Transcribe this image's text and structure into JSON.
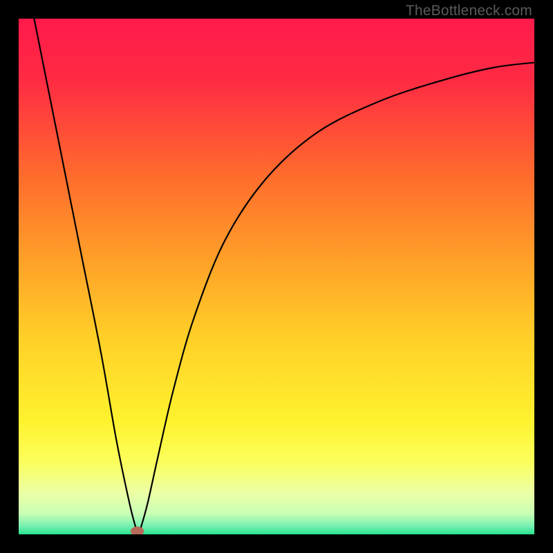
{
  "watermark": "TheBottleneck.com",
  "chart_data": {
    "type": "line",
    "title": "",
    "xlabel": "",
    "ylabel": "",
    "xlim": [
      0,
      100
    ],
    "ylim": [
      0,
      100
    ],
    "background": {
      "type": "vertical-gradient",
      "stops": [
        {
          "offset": 0.0,
          "color": "#ff1a4b"
        },
        {
          "offset": 0.12,
          "color": "#ff2b43"
        },
        {
          "offset": 0.3,
          "color": "#ff6a2d"
        },
        {
          "offset": 0.48,
          "color": "#ffa428"
        },
        {
          "offset": 0.62,
          "color": "#ffd028"
        },
        {
          "offset": 0.78,
          "color": "#fff22e"
        },
        {
          "offset": 0.86,
          "color": "#fbff5c"
        },
        {
          "offset": 0.92,
          "color": "#ecffa6"
        },
        {
          "offset": 0.96,
          "color": "#c8ffb4"
        },
        {
          "offset": 0.985,
          "color": "#72efb0"
        },
        {
          "offset": 1.0,
          "color": "#26e38f"
        }
      ]
    },
    "series": [
      {
        "name": "bottleneck-curve",
        "color": "#000000",
        "width": 2.2,
        "points": [
          {
            "x": 3.0,
            "y": 100.0
          },
          {
            "x": 5.0,
            "y": 90.0
          },
          {
            "x": 8.0,
            "y": 75.0
          },
          {
            "x": 12.0,
            "y": 55.0
          },
          {
            "x": 16.0,
            "y": 35.0
          },
          {
            "x": 19.0,
            "y": 18.0
          },
          {
            "x": 21.5,
            "y": 6.0
          },
          {
            "x": 22.8,
            "y": 1.0
          },
          {
            "x": 23.2,
            "y": 0.0
          },
          {
            "x": 23.6,
            "y": 1.0
          },
          {
            "x": 25.0,
            "y": 6.0
          },
          {
            "x": 27.0,
            "y": 15.0
          },
          {
            "x": 30.0,
            "y": 28.0
          },
          {
            "x": 34.0,
            "y": 42.0
          },
          {
            "x": 40.0,
            "y": 57.0
          },
          {
            "x": 48.0,
            "y": 69.0
          },
          {
            "x": 58.0,
            "y": 78.0
          },
          {
            "x": 70.0,
            "y": 84.0
          },
          {
            "x": 82.0,
            "y": 88.0
          },
          {
            "x": 92.0,
            "y": 90.5
          },
          {
            "x": 100.0,
            "y": 91.5
          }
        ]
      }
    ],
    "marker": {
      "name": "optimum-marker",
      "x": 23.0,
      "y": 0.6,
      "rx": 1.3,
      "ry": 0.9,
      "color": "#b86a5a"
    }
  }
}
